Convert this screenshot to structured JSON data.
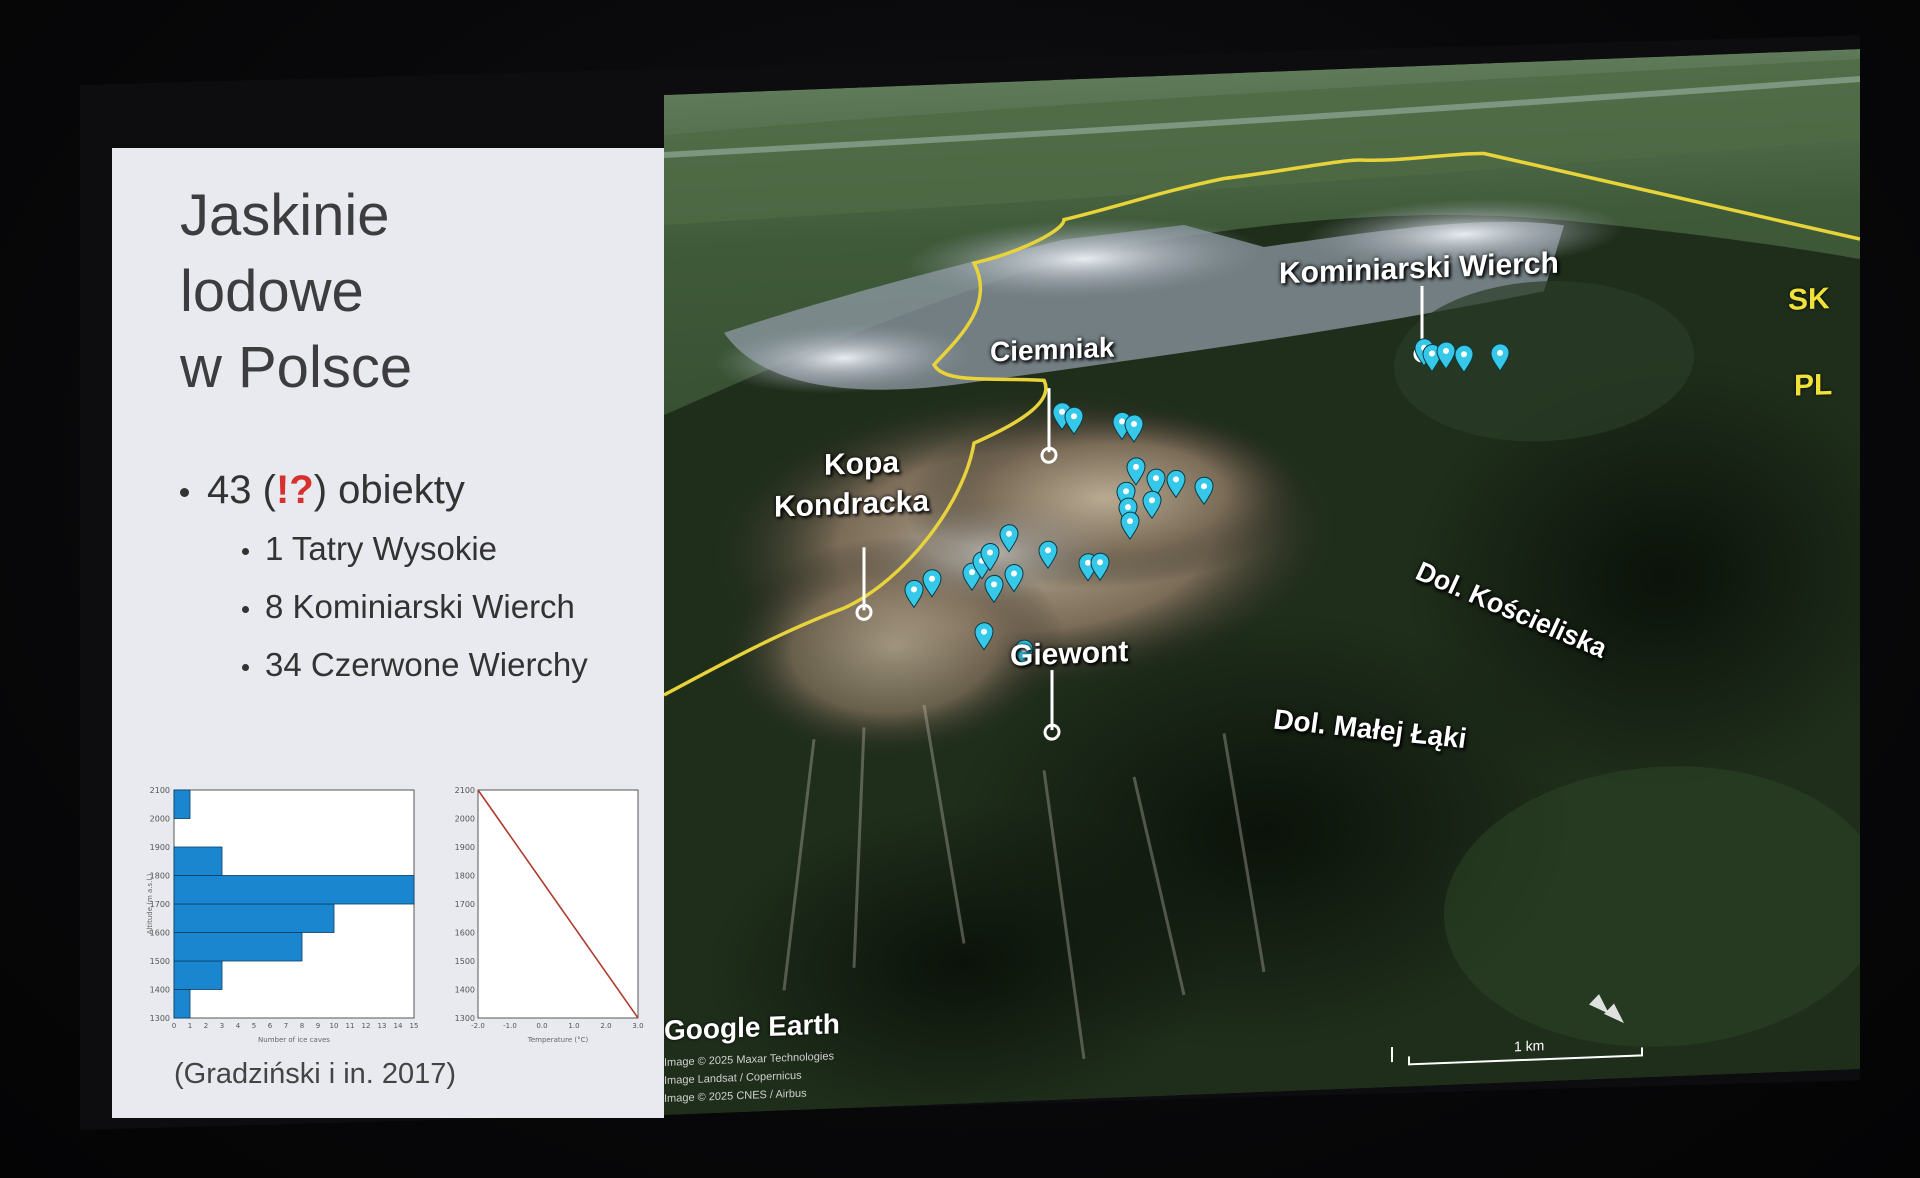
{
  "slide": {
    "title_lines": [
      "Jaskinie",
      "lodowe",
      "w Polsce"
    ],
    "bullet_main_prefix": "43 (",
    "bullet_main_mark": "!?",
    "bullet_main_suffix": ") obiekty",
    "sub_bullets": [
      "1 Tatry Wysokie",
      "8 Kominiarski Wierch",
      "34 Czerwone Wierchy"
    ],
    "citation": "(Gradziński i in. 2017)"
  },
  "chart_data": [
    {
      "type": "bar",
      "orientation": "horizontal",
      "categories": [
        "1300-1400",
        "1400-1500",
        "1500-1600",
        "1600-1700",
        "1700-1800",
        "1800-1900",
        "1900-2000",
        "2000-2100"
      ],
      "values": [
        1,
        3,
        8,
        10,
        15,
        3,
        0,
        1
      ],
      "xlabel": "Number of ice caves",
      "ylabel": "Altitude (m a.s.l.)",
      "ylim": [
        1300,
        2100
      ],
      "xlim": [
        0,
        15
      ],
      "y_ticks": [
        "1300",
        "1400",
        "1500",
        "1600",
        "1700",
        "1800",
        "1900",
        "2000",
        "2100"
      ],
      "x_ticks": [
        "0",
        "1",
        "2",
        "3",
        "4",
        "5",
        "6",
        "7",
        "8",
        "9",
        "10",
        "11",
        "12",
        "13",
        "14",
        "15"
      ],
      "color": "#1a86d0"
    },
    {
      "type": "line",
      "x": [
        -2.0,
        3.0
      ],
      "y": [
        2100,
        1300
      ],
      "xlabel": "Temperature (°C)",
      "ylim": [
        1300,
        2100
      ],
      "xlim": [
        -2.0,
        3.0
      ],
      "x_ticks": [
        "-2.0",
        "-1.0",
        "0.0",
        "1.0",
        "2.0",
        "3.0"
      ],
      "y_ticks": [
        "1300",
        "1400",
        "1500",
        "1600",
        "1700",
        "1800",
        "1900",
        "2000",
        "2100"
      ],
      "color": "#b03a2e"
    }
  ],
  "map": {
    "labels": {
      "kominiarski": "Kominiarski Wierch",
      "ciemniak": "Ciemniak",
      "kopa1": "Kopa",
      "kopa2": "Kondracka",
      "giewont": "Giewont",
      "koscieliska": "Dol. Kościeliska",
      "malej": "Dol. Małej Łąki",
      "sk": "SK",
      "pl": "PL"
    },
    "brand": "Google Earth",
    "credits": [
      "Image © 2025 Maxar Technologies",
      "Image Landsat / Copernicus",
      "Image © 2025 CNES / Airbus"
    ],
    "scale": "1 km",
    "marker_color": "#35c8e8",
    "border_color": "#e8d43a"
  }
}
